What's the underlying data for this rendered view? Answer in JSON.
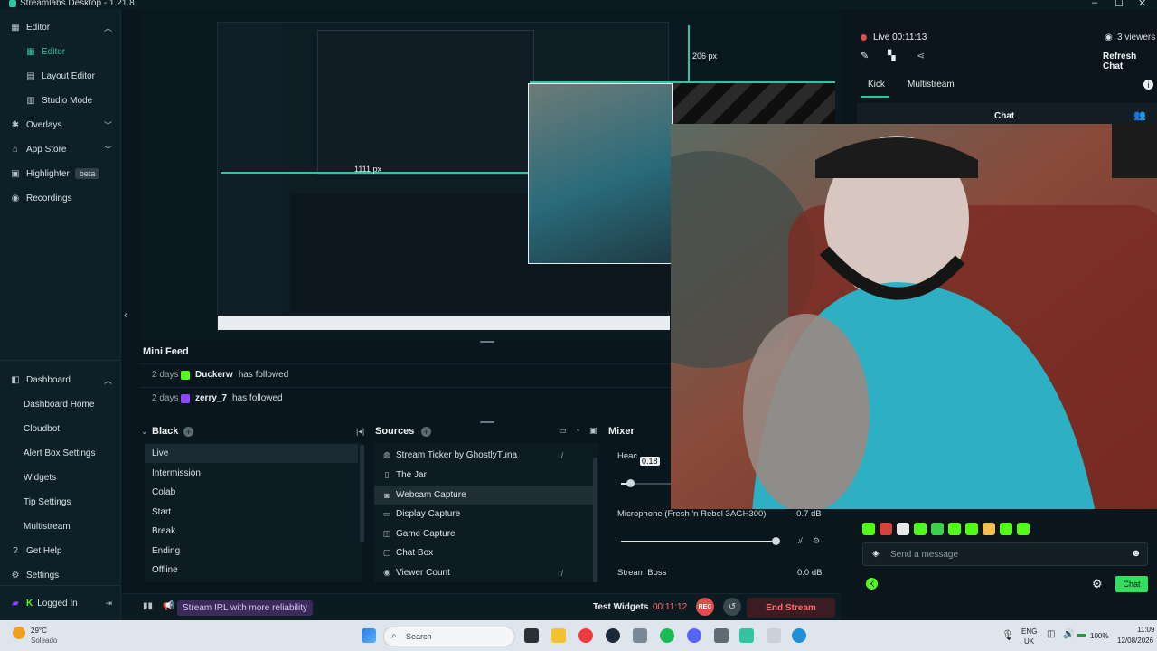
{
  "window": {
    "title": "Streamlabs Desktop - 1.21.8",
    "controls": [
      "–",
      "☐",
      "✕"
    ]
  },
  "sidebar": {
    "items": [
      {
        "label": "Editor",
        "icon": "editor-icon",
        "expanded": true
      },
      {
        "label": "Editor",
        "icon": "grid-icon",
        "sub": true,
        "active": true
      },
      {
        "label": "Layout Editor",
        "icon": "layout-icon",
        "sub": true
      },
      {
        "label": "Studio Mode",
        "icon": "studio-icon",
        "sub": true
      },
      {
        "label": "Overlays",
        "icon": "overlays-icon"
      },
      {
        "label": "App Store",
        "icon": "store-icon"
      },
      {
        "label": "Highlighter",
        "icon": "highlighter-icon",
        "badge": "beta"
      },
      {
        "label": "Recordings",
        "icon": "recordings-icon"
      }
    ],
    "dashboard": {
      "label": "Dashboard",
      "items": [
        "Dashboard Home",
        "Cloudbot",
        "Alert Box Settings",
        "Widgets",
        "Tip Settings",
        "Multistream"
      ]
    },
    "bottom": {
      "help": "Get Help",
      "settings": "Settings",
      "logged_in": "Logged In"
    }
  },
  "preview": {
    "measure_top": "206 px",
    "measure_left": "1111 px"
  },
  "mini_feed": {
    "title": "Mini Feed",
    "rows": [
      {
        "ago": "2 days",
        "platform": "kick",
        "user": "Duckerw",
        "action": "has followed"
      },
      {
        "ago": "2 days",
        "platform": "twitch",
        "user": "zerry_7",
        "action": "has followed"
      }
    ]
  },
  "scenes": {
    "title": "Black",
    "items": [
      "Live",
      "Intermission",
      "Colab",
      "Start",
      "Break",
      "Ending",
      "Offline"
    ],
    "selected": 0
  },
  "sources": {
    "title": "Sources",
    "items": [
      {
        "label": "Stream Ticker by GhostlyTuna",
        "icon": "web-icon",
        "hidden": true
      },
      {
        "label": "The Jar",
        "icon": "jar-icon"
      },
      {
        "label": "Webcam Capture",
        "icon": "camera-icon",
        "selected": true
      },
      {
        "label": "Display Capture",
        "icon": "monitor-icon"
      },
      {
        "label": "Game Capture",
        "icon": "gamepad-icon"
      },
      {
        "label": "Chat Box",
        "icon": "chat-icon"
      },
      {
        "label": "Viewer Count",
        "icon": "eye-icon",
        "hidden": true
      }
    ]
  },
  "mixer": {
    "title": "Mixer",
    "headset_label": "Heac",
    "headset_tooltip": "0.18",
    "headset_level": 0.18,
    "mic_label": "Microphone (Fresh 'n Rebel 3AGH300)",
    "mic_db": "-0.7 dB",
    "mic_level": 0.98,
    "stream_boss_label": "Stream Boss",
    "stream_boss_db": "0.0 dB"
  },
  "footer": {
    "irl": "Stream IRL with more reliability",
    "test_widgets": "Test Widgets",
    "timer": "00:11:12",
    "rec": "REC",
    "end_stream": "End Stream"
  },
  "right_panel": {
    "live_label": "Live 00:11:13",
    "viewers": "3 viewers",
    "refresh": "Refresh Chat",
    "tabs": [
      "Kick",
      "Multistream"
    ],
    "chat_title": "Chat",
    "message_placeholder": "Send a message",
    "send_label": "Chat"
  },
  "taskbar": {
    "weather_temp": "29°C",
    "weather_desc": "Soleado",
    "search": "Search",
    "lang": "ENG",
    "region": "UK",
    "battery": "100%",
    "time": "11:09",
    "date": "12/08/2026"
  },
  "colors": {
    "accent": "#31c3a2",
    "live": "#e24c4c",
    "kick": "#53fc18",
    "twitch": "#9146ff"
  }
}
